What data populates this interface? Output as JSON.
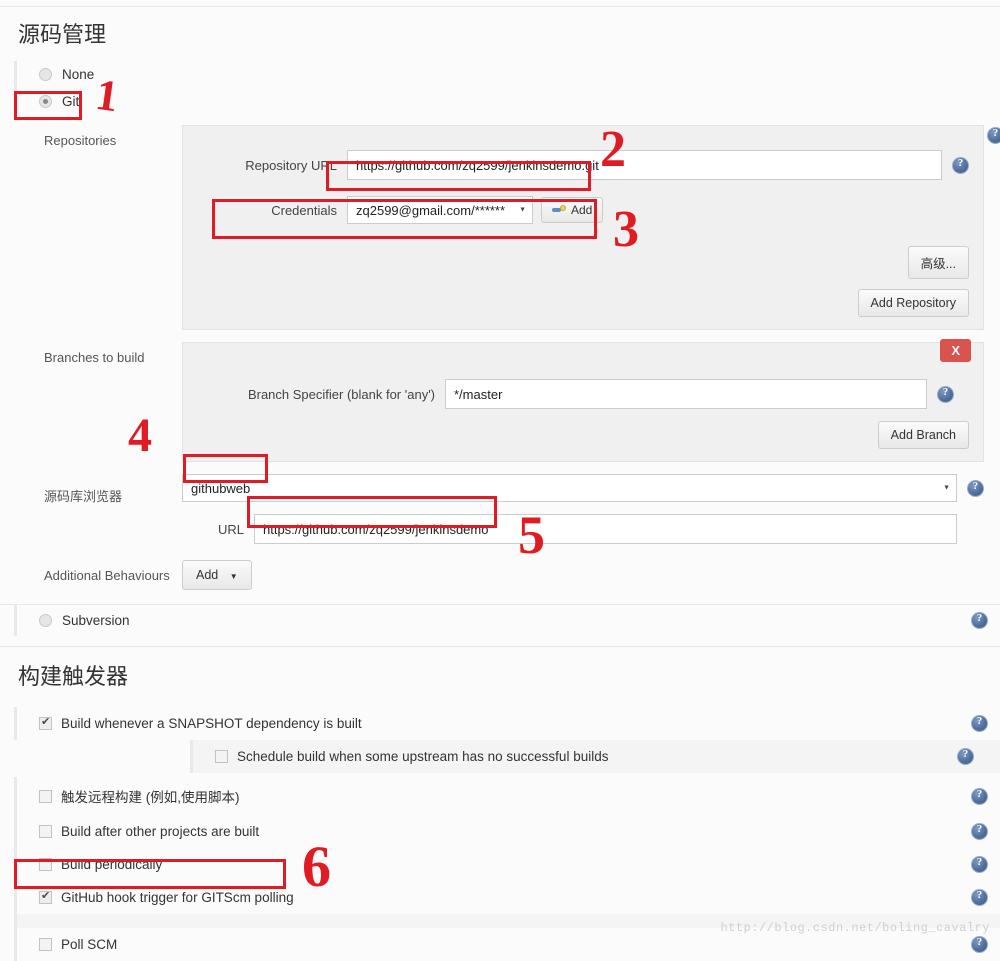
{
  "sections": {
    "scm_title": "源码管理",
    "triggers_title": "构建触发器"
  },
  "scm_options": [
    {
      "label": "None",
      "selected": false
    },
    {
      "label": "Git",
      "selected": true
    },
    {
      "label": "Subversion",
      "selected": false
    }
  ],
  "git": {
    "repositories_label": "Repositories",
    "repository_url_label": "Repository URL",
    "repository_url_value": "https://github.com/zq2599/jenkinsdemo.git",
    "credentials_label": "Credentials",
    "credentials_value": "zq2599@gmail.com/******",
    "add_credentials_label": "Add",
    "advanced_label": "高级...",
    "add_repository_label": "Add Repository",
    "branches_label": "Branches to build",
    "branch_specifier_label": "Branch Specifier (blank for 'any')",
    "branch_specifier_value": "*/master",
    "delete_branch_label": "X",
    "add_branch_label": "Add Branch",
    "repo_browser_label": "源码库浏览器",
    "repo_browser_value": "githubweb",
    "browser_url_label": "URL",
    "browser_url_value": "https://github.com/zq2599/jenkinsdemo",
    "additional_behaviours_label": "Additional Behaviours",
    "add_behaviour_label": "Add"
  },
  "triggers": [
    {
      "label": "Build whenever a SNAPSHOT dependency is built",
      "checked": true,
      "indent": false,
      "alt": false
    },
    {
      "label": "Schedule build when some upstream has no successful builds",
      "checked": false,
      "indent": true,
      "alt": true
    },
    {
      "label": "触发远程构建 (例如,使用脚本)",
      "checked": false,
      "indent": false,
      "alt": false
    },
    {
      "label": "Build after other projects are built",
      "checked": false,
      "indent": false,
      "alt": false
    },
    {
      "label": "Build periodically",
      "checked": false,
      "indent": false,
      "alt": false
    },
    {
      "label": "GitHub hook trigger for GITScm polling",
      "checked": true,
      "indent": false,
      "alt": false
    },
    {
      "label": "Poll SCM",
      "checked": false,
      "indent": false,
      "alt": false
    }
  ],
  "annotations": {
    "n1": "1",
    "n2": "2",
    "n3": "3",
    "n4": "4",
    "n5": "5",
    "n6": "6",
    "color": "#e01b24"
  },
  "watermark": "http://blog.csdn.net/boling_cavalry"
}
